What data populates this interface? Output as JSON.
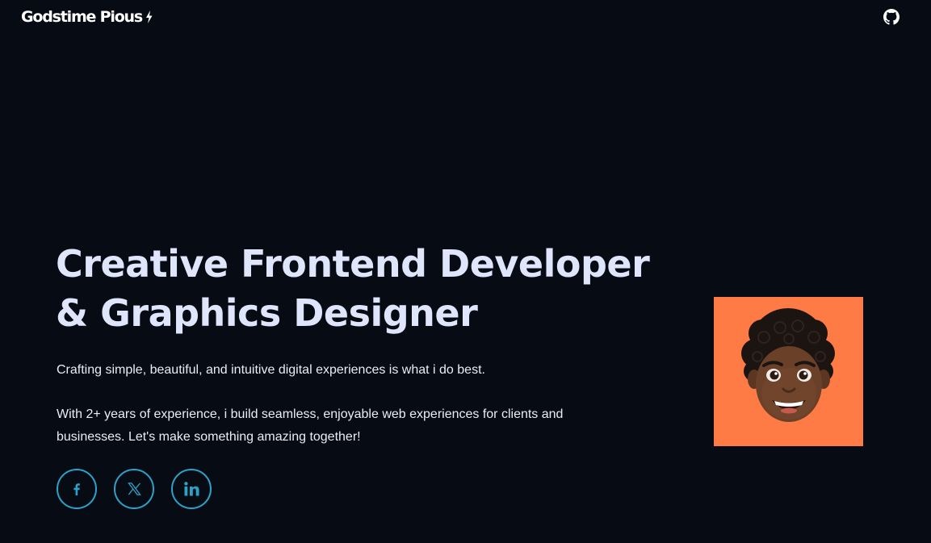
{
  "header": {
    "brand": "Godstime Pious",
    "brand_icon": "lightning-bolt-icon",
    "github_icon": "github-icon"
  },
  "hero": {
    "title_line1": "Creative Frontend Developer",
    "title_line2": "& Graphics Designer",
    "tagline": "Crafting simple, beautiful, and intuitive digital experiences is what i do best.",
    "bio": "With 2+ years of experience, i build seamless, enjoyable web experiences for clients and businesses. Let's make something amazing together!"
  },
  "socials": [
    {
      "icon": "facebook-icon"
    },
    {
      "icon": "x-twitter-icon"
    },
    {
      "icon": "linkedin-icon"
    }
  ],
  "avatar": {
    "icon": "memoji-avatar"
  },
  "colors": {
    "background": "#070b14",
    "heading": "#dfe6fb",
    "body_text": "#e9edf7",
    "accent": "#2ba3c9",
    "avatar_bg": "#ff7b45"
  }
}
